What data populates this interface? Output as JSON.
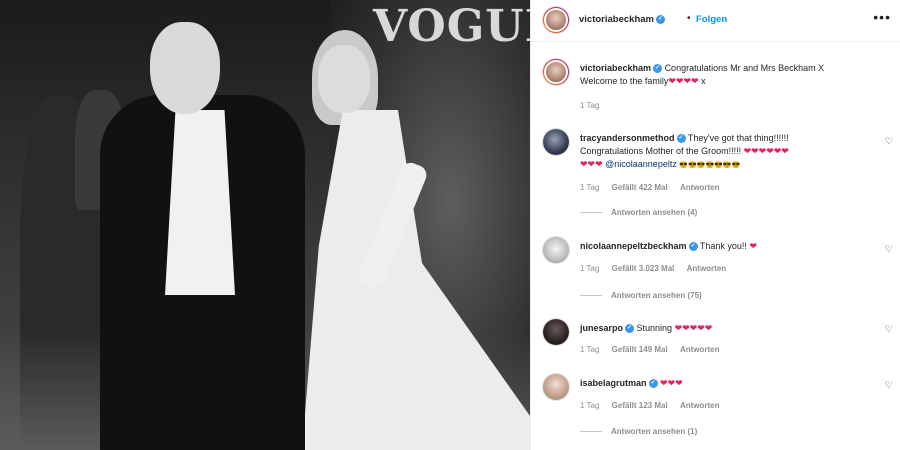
{
  "photo": {
    "brand": "VOGUE"
  },
  "header": {
    "username": "victoriabeckham",
    "follow_label": "Folgen",
    "more_icon": "more-horizontal-icon"
  },
  "caption": {
    "username": "victoriabeckham",
    "text_line1": "Congratulations Mr and Mrs Beckham X",
    "text_line2_prefix": "Welcome to the family",
    "hearts": "❤❤❤❤",
    "suffix": "x",
    "time": "1 Tag"
  },
  "comments": [
    {
      "username": "tracyandersonmethod",
      "text_line1": "They've got that thing!!!!!!",
      "text_line2": "Congratulations Mother of the Groom!!!!!",
      "hearts_line2": "❤❤❤❤❤❤",
      "hearts_line3": "❤❤❤",
      "mention": "@nicolaannepeltz",
      "emoji_tail": "😎😎😎😎😎😎😎",
      "time": "1 Tag",
      "likes": "Gefällt 422 Mal",
      "reply": "Antworten",
      "view_replies": "Antworten ansehen (4)"
    },
    {
      "username": "nicolaannepeltzbeckham",
      "text": "Thank you!!",
      "hearts": "❤",
      "time": "1 Tag",
      "likes": "Gefällt 3.023 Mal",
      "reply": "Antworten",
      "view_replies": "Antworten ansehen (75)"
    },
    {
      "username": "junesarpo",
      "text": "Stunning",
      "hearts": "❤❤❤❤❤",
      "time": "1 Tag",
      "likes": "Gefällt 149 Mal",
      "reply": "Antworten"
    },
    {
      "username": "isabelagrutman",
      "text": "",
      "hearts": "❤❤❤",
      "time": "1 Tag",
      "likes": "Gefällt 123 Mal",
      "reply": "Antworten",
      "view_replies": "Antworten ansehen (1)"
    }
  ],
  "colors": {
    "link": "#0095f6",
    "verified": "#3897f0",
    "heart": "#e0245e",
    "meta": "#8e8e8e"
  }
}
